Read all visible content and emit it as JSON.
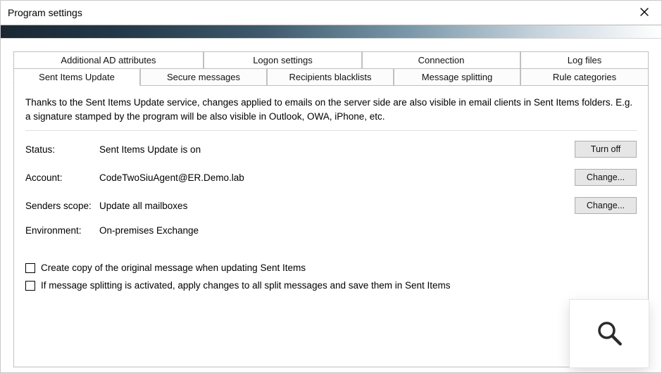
{
  "window": {
    "title": "Program settings"
  },
  "tabs_top": [
    {
      "label": "Additional AD attributes"
    },
    {
      "label": "Logon settings"
    },
    {
      "label": "Connection"
    },
    {
      "label": "Log files"
    }
  ],
  "tabs_bottom": [
    {
      "label": "Sent Items Update",
      "active": true
    },
    {
      "label": "Secure messages"
    },
    {
      "label": "Recipients blacklists"
    },
    {
      "label": "Message splitting"
    },
    {
      "label": "Rule categories"
    }
  ],
  "panel": {
    "intro": "Thanks to the Sent Items Update service, changes applied to emails on the server side are also visible in email clients in Sent Items folders. E.g. a signature stamped by the program will be also visible in Outlook, OWA, iPhone, etc.",
    "rows": {
      "status": {
        "label": "Status:",
        "value": "Sent Items Update is on",
        "button": "Turn off"
      },
      "account": {
        "label": "Account:",
        "value": "CodeTwoSiuAgent@ER.Demo.lab",
        "button": "Change..."
      },
      "scope": {
        "label": "Senders scope:",
        "value": "Update all mailboxes",
        "button": "Change..."
      },
      "env": {
        "label": "Environment:",
        "value": "On-premises Exchange",
        "button": null
      }
    },
    "checks": [
      {
        "label": "Create copy of the original message when updating Sent Items",
        "checked": false
      },
      {
        "label": "If message splitting is activated, apply changes to all split messages and save them in Sent Items",
        "checked": false
      }
    ]
  }
}
